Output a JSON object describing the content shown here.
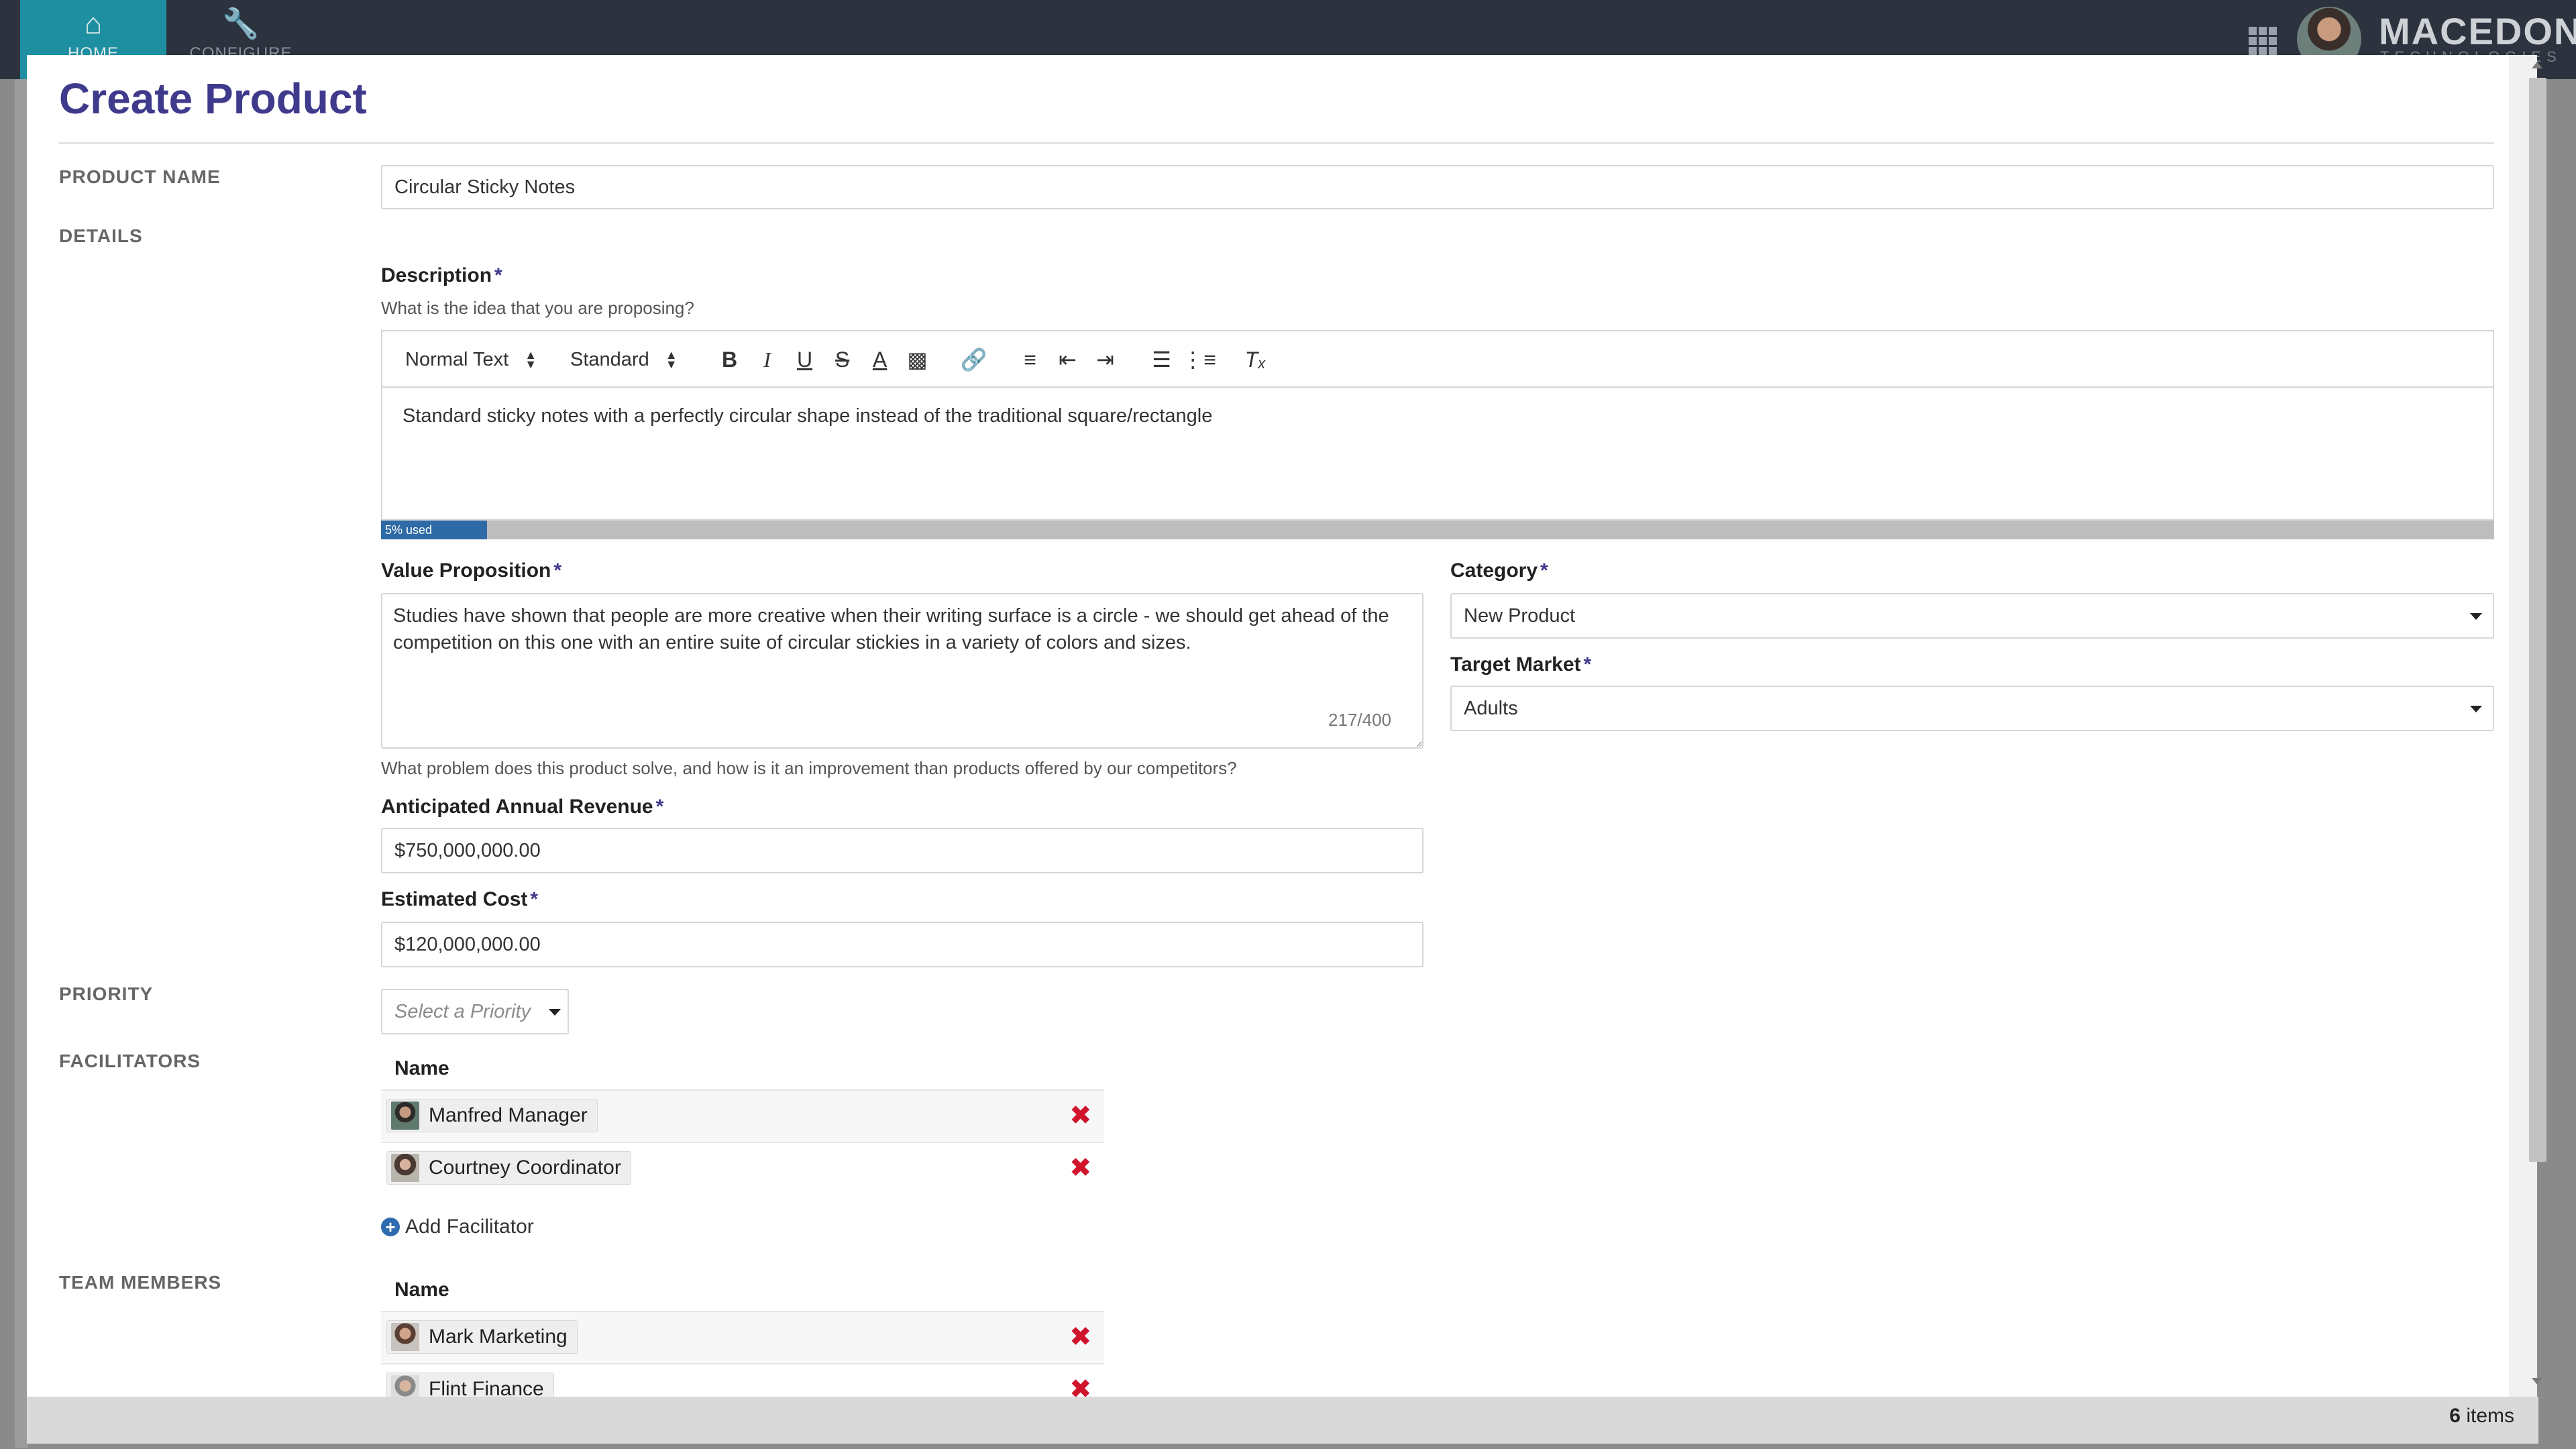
{
  "topbar": {
    "nav": [
      {
        "label": "HOME",
        "icon": "home-icon"
      },
      {
        "label": "CONFIGURE",
        "icon": "wrench-icon"
      }
    ],
    "brand": "MACEDON",
    "brand_sub": "TECHNOLOGIES"
  },
  "modal": {
    "title": "Create Product",
    "sections": {
      "product_name": "PRODUCT NAME",
      "details": "DETAILS",
      "priority": "PRIORITY",
      "facilitators": "FACILITATORS",
      "team_members": "TEAM MEMBERS"
    },
    "product_name_value": "Circular Sticky Notes",
    "description": {
      "label": "Description",
      "required": "*",
      "hint": "What is the idea that you are proposing?",
      "toolbar": {
        "format": "Normal Text",
        "font": "Standard",
        "buttons": [
          "bold-icon",
          "italic-icon",
          "underline-icon",
          "strikethrough-icon",
          "text-color-icon",
          "highlight-icon",
          "link-icon",
          "align-icon",
          "outdent-icon",
          "indent-icon",
          "ordered-list-icon",
          "bullet-list-icon",
          "clear-format-icon"
        ]
      },
      "text": "Standard sticky notes with a perfectly circular shape instead of the traditional square/rectangle",
      "usage_label": "5% used",
      "usage_fraction": 0.05
    },
    "value_proposition": {
      "label": "Value Proposition",
      "required": "*",
      "text": "Studies have shown that people are more creative when their writing surface is a circle - we should get ahead of the competition on this one with an entire suite of circular stickies in a variety of colors and sizes.",
      "count": "217/400",
      "hint": "What problem does this product solve, and how is it an improvement than products offered by our competitors?"
    },
    "category": {
      "label": "Category",
      "required": "*",
      "value": "New Product"
    },
    "target_market": {
      "label": "Target Market",
      "required": "*",
      "value": "Adults"
    },
    "revenue": {
      "label": "Anticipated Annual Revenue",
      "required": "*",
      "value": "$750,000,000.00"
    },
    "cost": {
      "label": "Estimated Cost",
      "required": "*",
      "value": "$120,000,000.00"
    },
    "priority_placeholder": "Select a Priority",
    "facilitators": {
      "column": "Name",
      "rows": [
        {
          "name": "Manfred Manager"
        },
        {
          "name": "Courtney Coordinator"
        }
      ],
      "add_label": "Add Facilitator"
    },
    "team_members": {
      "column": "Name",
      "rows": [
        {
          "name": "Mark Marketing"
        },
        {
          "name": "Flint Finance"
        }
      ]
    }
  },
  "footer": {
    "count": "6",
    "count_label": "items"
  },
  "colors": {
    "accent": "#3f3a8c",
    "nav_active": "#1e8fa0",
    "remove": "#d0142c",
    "usage": "#2e6aa6"
  }
}
